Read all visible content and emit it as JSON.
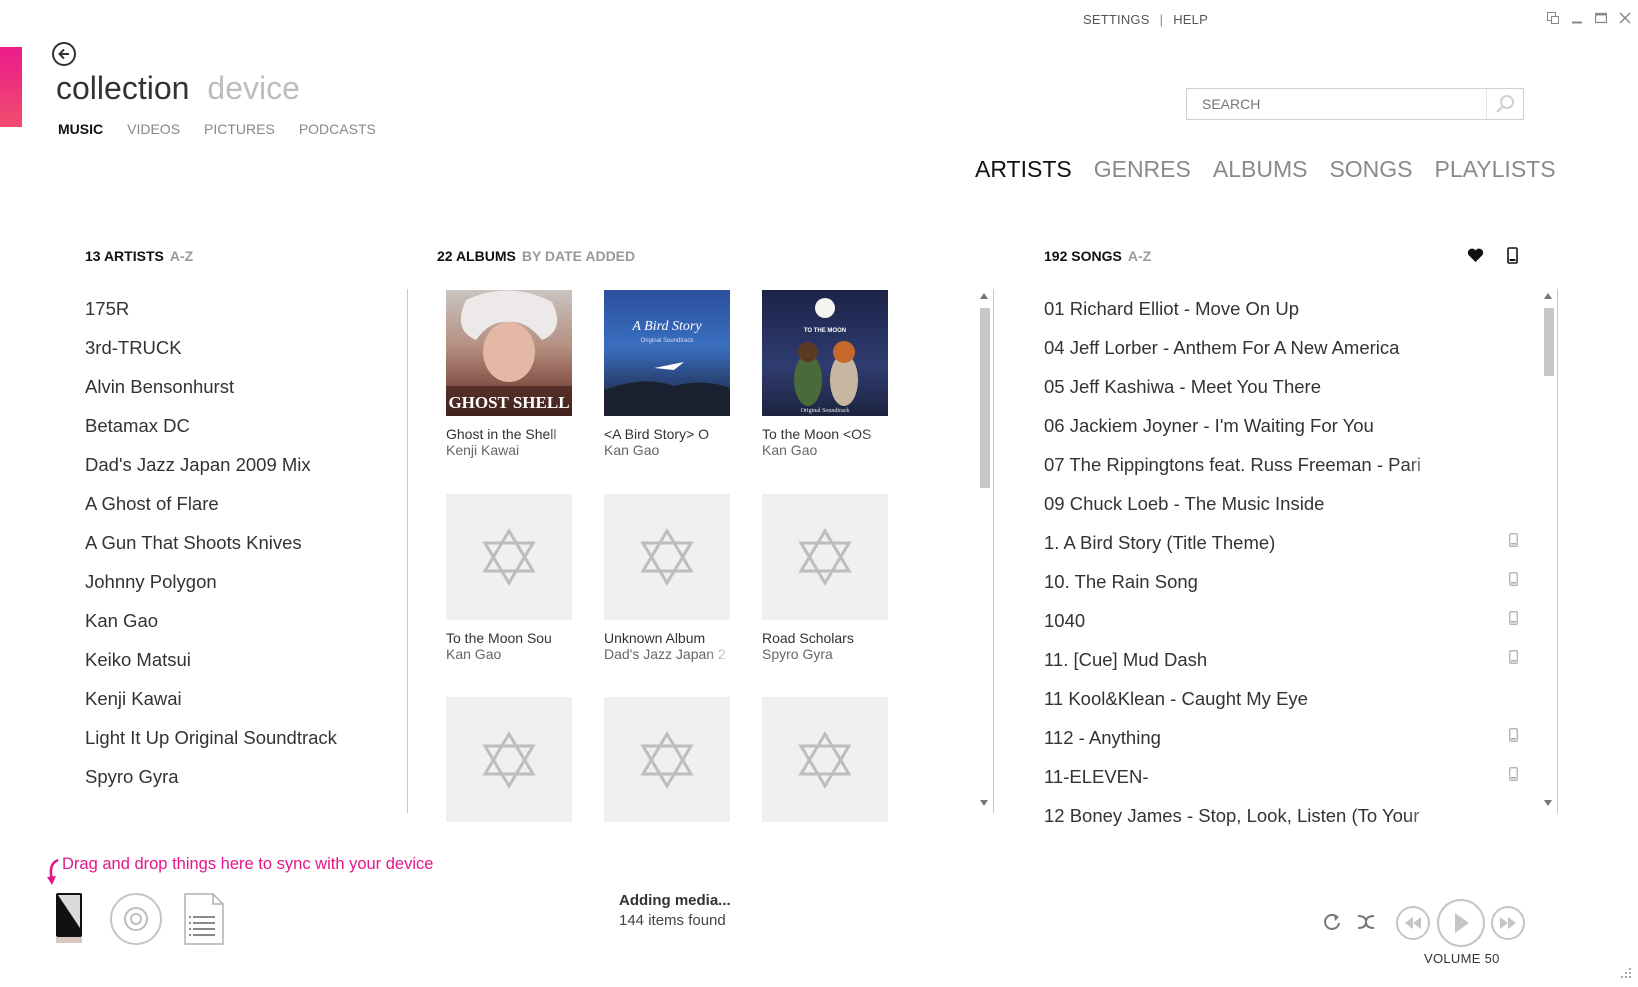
{
  "header": {
    "settings_label": "SETTINGS",
    "separator": "|",
    "help_label": "HELP",
    "pivot_active": "collection",
    "pivot_inactive": "device",
    "subnav": [
      "MUSIC",
      "VIDEOS",
      "PICTURES",
      "PODCASTS"
    ],
    "search_placeholder": "SEARCH",
    "view_tabs": [
      "ARTISTS",
      "GENRES",
      "ALBUMS",
      "SONGS",
      "PLAYLISTS"
    ]
  },
  "artists": {
    "count_label": "13 ARTISTS",
    "sort": "A-Z",
    "items": [
      "175R",
      "3rd-TRUCK",
      "Alvin Bensonhurst",
      "Betamax DC",
      "Dad's Jazz Japan 2009 Mix",
      "A Ghost of Flare",
      "A Gun That Shoots Knives",
      "Johnny Polygon",
      "Kan Gao",
      "Keiko Matsui",
      "Kenji Kawai",
      "Light It Up Original Soundtrack",
      "Spyro Gyra"
    ]
  },
  "albums": {
    "count_label": "22 ALBUMS",
    "sort": "BY DATE ADDED",
    "items": [
      {
        "title": "Ghost in the Shell",
        "artist": "Kenji Kawai",
        "art_text": "GHOST SHELL"
      },
      {
        "title": "<A Bird Story> O",
        "artist": "Kan Gao",
        "art_text": "A Bird Story",
        "art_sub": "Original Soundtrack"
      },
      {
        "title": "To the Moon <OS",
        "artist": "Kan Gao",
        "art_text": "TO THE MOON",
        "art_sub": "Original Soundtrack"
      },
      {
        "title": "To the Moon Sou",
        "artist": "Kan Gao"
      },
      {
        "title": "Unknown Album",
        "artist": "Dad's Jazz Japan 2"
      },
      {
        "title": "Road Scholars",
        "artist": "Spyro Gyra"
      },
      {
        "title": "",
        "artist": ""
      },
      {
        "title": "",
        "artist": ""
      },
      {
        "title": "",
        "artist": ""
      }
    ]
  },
  "songs": {
    "count_label": "192 SONGS",
    "sort": "A-Z",
    "items": [
      {
        "title": "01 Richard Elliot - Move On Up",
        "on_device": false
      },
      {
        "title": "04 Jeff Lorber - Anthem For A New America",
        "on_device": false
      },
      {
        "title": "05 Jeff Kashiwa - Meet You There",
        "on_device": false
      },
      {
        "title": "06 Jackiem Joyner - I'm Waiting For You",
        "on_device": false
      },
      {
        "title": "07 The Rippingtons feat. Russ Freeman - Pari",
        "on_device": false
      },
      {
        "title": "09 Chuck Loeb - The Music Inside",
        "on_device": false
      },
      {
        "title": "1. A Bird Story (Title Theme)",
        "on_device": true
      },
      {
        "title": "10. The Rain Song",
        "on_device": true
      },
      {
        "title": "1040",
        "on_device": true
      },
      {
        "title": "11. [Cue] Mud Dash",
        "on_device": true
      },
      {
        "title": "11 Kool&Klean - Caught My Eye",
        "on_device": false
      },
      {
        "title": "112 - Anything",
        "on_device": true
      },
      {
        "title": "11-ELEVEN-",
        "on_device": true
      },
      {
        "title": "12 Boney James - Stop, Look, Listen (To Your",
        "on_device": false
      }
    ]
  },
  "footer": {
    "drag_tip": "Drag and drop things here to sync with your device",
    "status_title": "Adding media...",
    "status_detail": "144 items found",
    "volume_label": "VOLUME 50"
  },
  "colors": {
    "accent": "#e5158a",
    "text_dark": "#222222",
    "text_muted": "#8a8a8a"
  }
}
